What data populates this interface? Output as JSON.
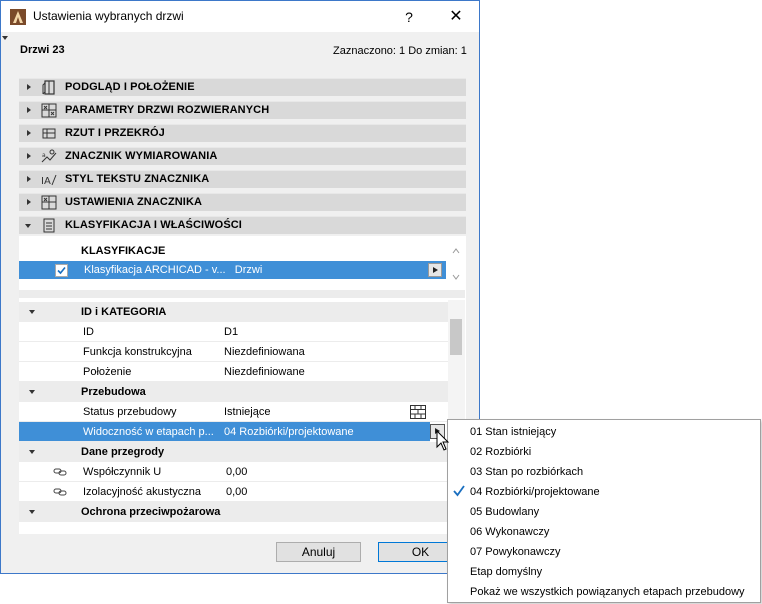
{
  "window": {
    "title": "Ustawienia wybranych drzwi",
    "help_label": "?",
    "close_label": "✕"
  },
  "header": {
    "element_name": "Drzwi 23",
    "selection_info": "Zaznaczono: 1 Do zmian: 1"
  },
  "sections": [
    {
      "label": "PODGLĄD I POŁOŻENIE",
      "icon": "door-preview-icon",
      "expanded": false
    },
    {
      "label": "PARAMETRY DRZWI ROZWIERANYCH",
      "icon": "parameters-icon",
      "expanded": false
    },
    {
      "label": "RZUT I PRZEKRÓJ",
      "icon": "plan-section-icon",
      "expanded": false
    },
    {
      "label": "ZNACZNIK WYMIAROWANIA",
      "icon": "dimension-marker-icon",
      "expanded": false
    },
    {
      "label": "STYL TEKSTU ZNACZNIKA",
      "icon": "text-style-icon",
      "expanded": false
    },
    {
      "label": "USTAWIENIA ZNACZNIKA",
      "icon": "marker-settings-icon",
      "expanded": false
    },
    {
      "label": "KLASYFIKACJA I WŁAŚCIWOŚCI",
      "icon": "classification-icon",
      "expanded": true
    }
  ],
  "classification": {
    "title": "KLASYFIKACJE",
    "checked": true,
    "row_text": "Klasyfikacja ARCHICAD - v...   Drzwi"
  },
  "properties": {
    "groups": [
      {
        "label": "ID i KATEGORIA",
        "rows": [
          {
            "key": "ID",
            "value": "D1"
          },
          {
            "key": "Funkcja konstrukcyjna",
            "value": "Niezdefiniowana"
          },
          {
            "key": "Położenie",
            "value": "Niezdefiniowane"
          }
        ]
      },
      {
        "label": "Przebudowa",
        "rows": [
          {
            "key": "Status przebudowy",
            "value": "Istniejące"
          },
          {
            "key": "Widoczność w etapach p...",
            "value": "04 Rozbiórki/projektowane"
          }
        ]
      },
      {
        "label": "Dane przegrody",
        "rows": [
          {
            "key": "Współczynnik U",
            "value": "0,00"
          },
          {
            "key": "Izolacyjność akustyczna",
            "value": "0,00"
          }
        ]
      },
      {
        "label": "Ochrona przeciwpożarowa",
        "rows": []
      }
    ]
  },
  "buttons": {
    "cancel": "Anuluj",
    "ok": "OK"
  },
  "dropdown": {
    "items": [
      {
        "label": "01 Stan istniejący",
        "checked": false
      },
      {
        "label": "02 Rozbiórki",
        "checked": false
      },
      {
        "label": "03 Stan po rozbiórkach",
        "checked": false
      },
      {
        "label": "04 Rozbiórki/projektowane",
        "checked": true
      },
      {
        "label": "05 Budowlany",
        "checked": false
      },
      {
        "label": "06 Wykonawczy",
        "checked": false
      },
      {
        "label": "07 Powykonawczy",
        "checked": false
      },
      {
        "label": "Etap domyślny",
        "checked": false
      },
      {
        "label": "Pokaż we wszystkich powiązanych etapach przebudowy",
        "checked": false
      }
    ]
  },
  "colors": {
    "selection": "#3f8fd7",
    "section_bg": "#d9d9d9",
    "window_border": "#3d78c9"
  }
}
